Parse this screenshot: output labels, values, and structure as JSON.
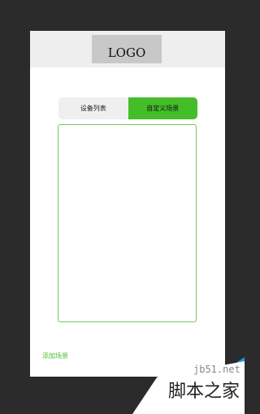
{
  "header": {
    "logo": "LOGO"
  },
  "tabs": [
    {
      "label": "设备列表",
      "active": false
    },
    {
      "label": "自定义场景",
      "active": true
    }
  ],
  "add_scene_label": "添加场景",
  "watermark": {
    "site": "jb51.net",
    "name": "脚本之家"
  },
  "colors": {
    "accent": "#44bd29",
    "background": "#2b2b2b",
    "panel_border": "#74c75f",
    "watermark_blue": "#1f9be0"
  }
}
